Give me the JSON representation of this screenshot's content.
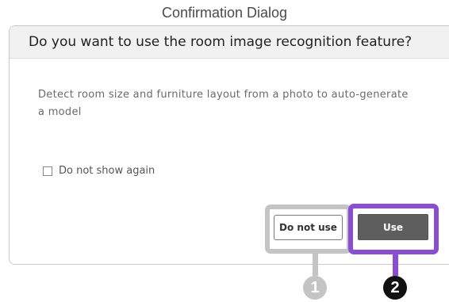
{
  "caption": "Confirmation Dialog",
  "dialog": {
    "title": "Do you want to use the room image recognition feature?",
    "message": "Detect room size and furniture layout from a photo to auto-generate a model",
    "checkbox": {
      "label": "Do not show again",
      "checked": false
    },
    "buttons": {
      "secondary": "Do not use",
      "primary": "Use"
    }
  },
  "callouts": [
    {
      "number": "1",
      "color": "#c4c4c4",
      "target": "Do not use"
    },
    {
      "number": "2",
      "color": "#8a4fd0",
      "target": "Use"
    }
  ]
}
